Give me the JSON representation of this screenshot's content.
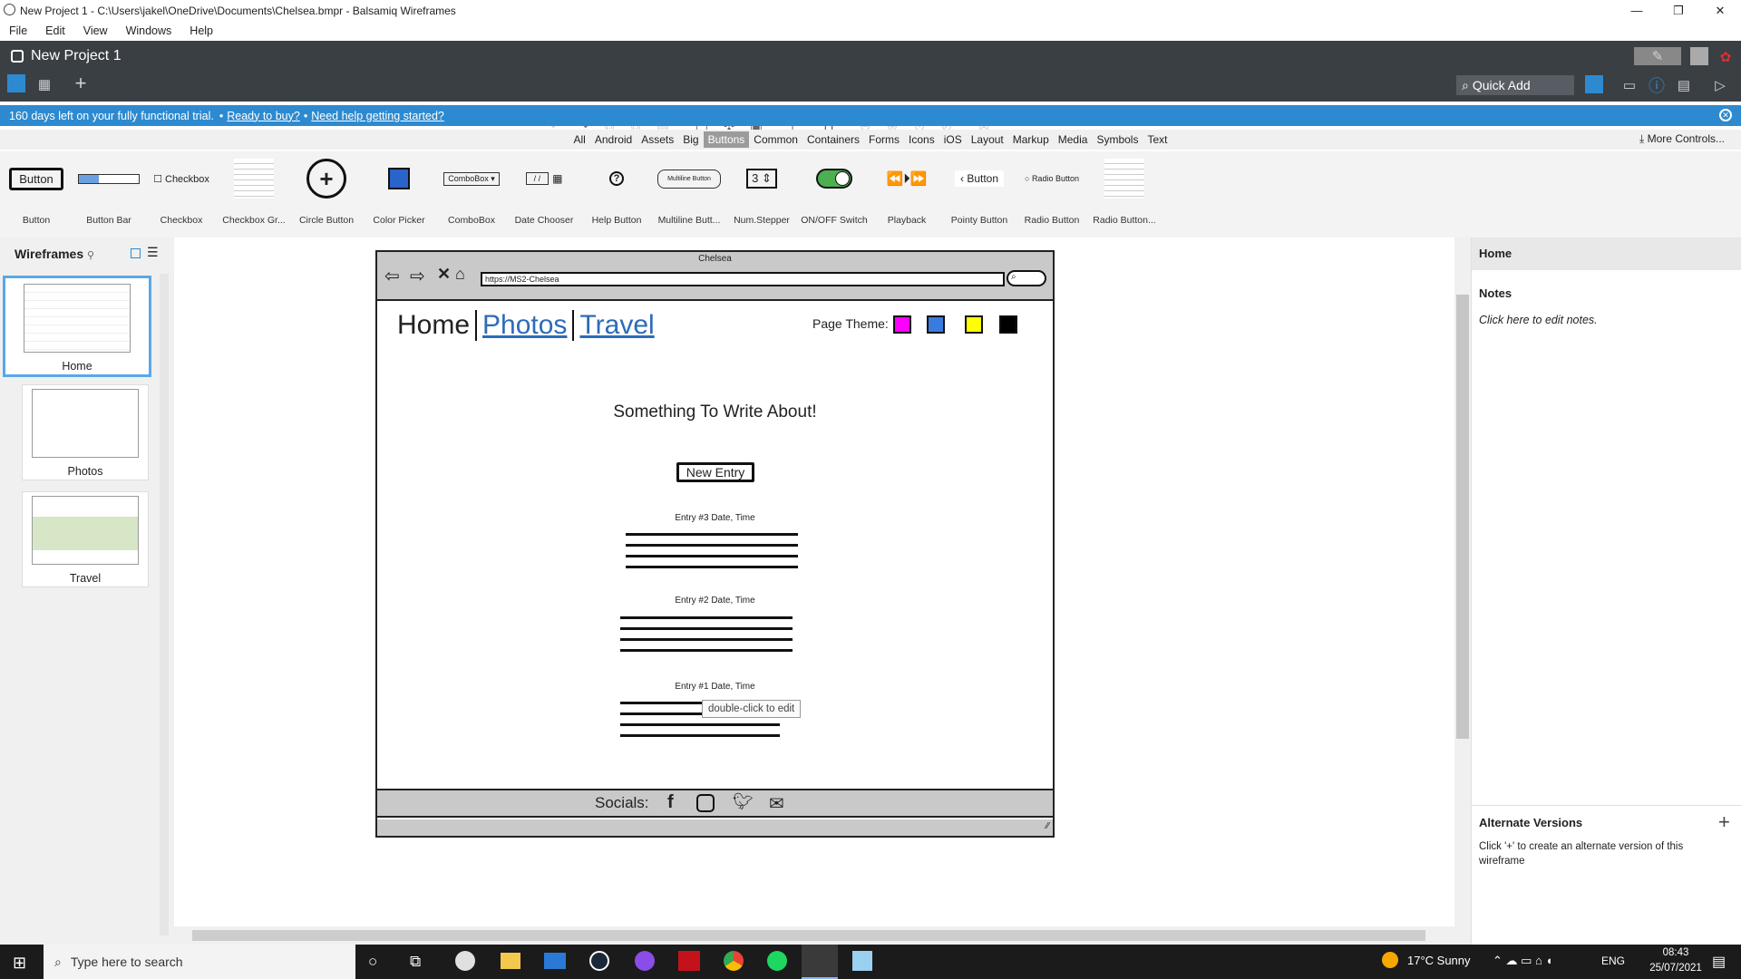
{
  "window": {
    "title": "New Project 1 - C:\\Users\\jakel\\OneDrive\\Documents\\Chelsea.bmpr - Balsamiq Wireframes",
    "minimize": "—",
    "restore": "❐",
    "close": "✕"
  },
  "menu": [
    "File",
    "Edit",
    "View",
    "Windows",
    "Help"
  ],
  "app": {
    "project_name": "New Project 1",
    "quick_add": "Quick Add"
  },
  "trial": {
    "message": "160 days left on your fully functional trial.",
    "sep": "•",
    "link1": "Ready to buy?",
    "link2": "Need help getting started?"
  },
  "categories": [
    "All",
    "Android",
    "Assets",
    "Big",
    "Buttons",
    "Common",
    "Containers",
    "Forms",
    "Icons",
    "iOS",
    "Layout",
    "Markup",
    "Media",
    "Symbols",
    "Text"
  ],
  "selected_category": "Buttons",
  "more_controls": "More Controls...",
  "controls": [
    {
      "label": "Button",
      "preview": "Button"
    },
    {
      "label": "Button Bar",
      "preview": ""
    },
    {
      "label": "Checkbox",
      "preview": "Checkbox"
    },
    {
      "label": "Checkbox Gr...",
      "preview": ""
    },
    {
      "label": "Circle Button",
      "preview": ""
    },
    {
      "label": "Color Picker",
      "preview": ""
    },
    {
      "label": "ComboBox",
      "preview": "ComboBox"
    },
    {
      "label": "Date Chooser",
      "preview": "/ /"
    },
    {
      "label": "Help Button",
      "preview": "?"
    },
    {
      "label": "Multiline Butt...",
      "preview": "Multiline Button"
    },
    {
      "label": "Num.Stepper",
      "preview": "3"
    },
    {
      "label": "ON/OFF Switch",
      "preview": ""
    },
    {
      "label": "Playback",
      "preview": ""
    },
    {
      "label": "Pointy Button",
      "preview": "Button"
    },
    {
      "label": "Radio Button",
      "preview": "Radio Button"
    },
    {
      "label": "Radio Button...",
      "preview": ""
    }
  ],
  "wireframes_panel": {
    "title": "Wireframes",
    "pages": [
      "Home",
      "Photos",
      "Travel"
    ],
    "selected": "Home"
  },
  "mockup": {
    "window_title": "Chelsea",
    "url": "https://MS2-Chelsea",
    "nav": [
      "Home",
      "Photos",
      "Travel"
    ],
    "page_theme_label": "Page Theme:",
    "theme_colors": [
      "#ff00ff",
      "#3a7be0",
      "#ffff00",
      "#000000"
    ],
    "heading": "Something To Write About!",
    "new_entry": "New Entry",
    "entries": [
      "Entry #3 Date, Time",
      "Entry #2 Date, Time",
      "Entry #1 Date, Time"
    ],
    "tooltip": "double-click to edit",
    "socials_label": "Socials:"
  },
  "properties": {
    "title": "Home",
    "notes_heading": "Notes",
    "notes_placeholder": "Click here to edit notes.",
    "alt_heading": "Alternate Versions",
    "alt_text": "Click '+' to create an alternate version of this wireframe"
  },
  "taskbar": {
    "search_placeholder": "Type here to search",
    "weather": "17°C  Sunny",
    "lang": "ENG",
    "time": "08:43",
    "date": "25/07/2021"
  }
}
